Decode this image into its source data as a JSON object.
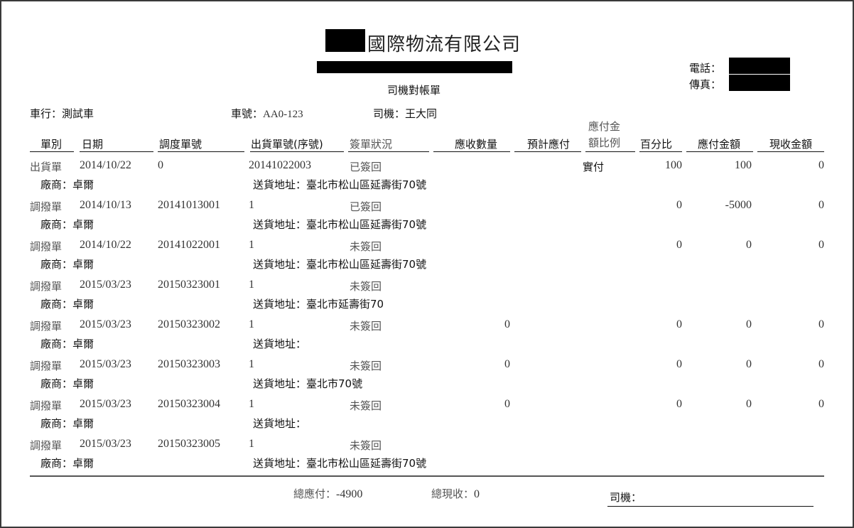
{
  "header": {
    "company_name": "國際物流有限公司",
    "doc_title": "司機對帳單",
    "phone_label": "電話：",
    "fax_label": "傳真："
  },
  "info": {
    "carrier_label": "車行：測試車",
    "plate_label": "車號：",
    "plate_value": "AA0-123",
    "driver_label": "司機：王大同"
  },
  "columns": {
    "type": "單別",
    "date": "日期",
    "dispatch_no": "調度單號",
    "ship_no": "出貨單號(序號)",
    "sign_status": "簽單狀況",
    "recv_qty": "應收數量",
    "est_pay": "預計應付",
    "pay_ratio_line1": "應付金",
    "pay_ratio_line2": "額比例",
    "percent": "百分比",
    "pay_amount": "應付金額",
    "cash_amount": "現收金額"
  },
  "rows": [
    {
      "type": "出貨單",
      "date": "2014/10/22",
      "dispatch": "0",
      "ship": "20141022003",
      "status": "已簽回",
      "qty": "",
      "ratio": "實付",
      "percent": "100",
      "pay": "100",
      "cash": "0",
      "vendor": "廠商：卓爾",
      "address": "送貨地址：臺北市松山區延壽街70號"
    },
    {
      "type": "調撥單",
      "date": "2014/10/13",
      "dispatch": "20141013001",
      "ship": "1",
      "status": "已簽回",
      "qty": "",
      "ratio": "",
      "percent": "0",
      "pay": "-5000",
      "cash": "0",
      "vendor": "廠商：卓爾",
      "address": "送貨地址：臺北市松山區延壽街70號"
    },
    {
      "type": "調撥單",
      "date": "2014/10/22",
      "dispatch": "20141022001",
      "ship": "1",
      "status": "未簽回",
      "qty": "",
      "ratio": "",
      "percent": "0",
      "pay": "0",
      "cash": "0",
      "vendor": "廠商：卓爾",
      "address": "送貨地址：臺北市松山區延壽街70號"
    },
    {
      "type": "調撥單",
      "date": "2015/03/23",
      "dispatch": "20150323001",
      "ship": "1",
      "status": "未簽回",
      "qty": "",
      "ratio": "",
      "percent": "",
      "pay": "",
      "cash": "",
      "vendor": "廠商：卓爾",
      "address": "送貨地址：臺北市延壽街70"
    },
    {
      "type": "調撥單",
      "date": "2015/03/23",
      "dispatch": "20150323002",
      "ship": "1",
      "status": "未簽回",
      "qty": "0",
      "ratio": "",
      "percent": "0",
      "pay": "0",
      "cash": "0",
      "vendor": "廠商：卓爾",
      "address": "送貨地址："
    },
    {
      "type": "調撥單",
      "date": "2015/03/23",
      "dispatch": "20150323003",
      "ship": "1",
      "status": "未簽回",
      "qty": "0",
      "ratio": "",
      "percent": "0",
      "pay": "0",
      "cash": "0",
      "vendor": "廠商：卓爾",
      "address": "送貨地址：臺北市70號"
    },
    {
      "type": "調撥單",
      "date": "2015/03/23",
      "dispatch": "20150323004",
      "ship": "1",
      "status": "未簽回",
      "qty": "0",
      "ratio": "",
      "percent": "0",
      "pay": "0",
      "cash": "0",
      "vendor": "廠商：卓爾",
      "address": "送貨地址："
    },
    {
      "type": "調撥單",
      "date": "2015/03/23",
      "dispatch": "20150323005",
      "ship": "1",
      "status": "未簽回",
      "qty": "",
      "ratio": "",
      "percent": "",
      "pay": "",
      "cash": "",
      "vendor": "廠商：卓爾",
      "address": "送貨地址：臺北市松山區延壽街70號"
    }
  ],
  "footer": {
    "total_pay_label": "總應付：",
    "total_pay_value": "-4900",
    "total_cash_label": "總現收：",
    "total_cash_value": "0",
    "driver_sign_label": "司機："
  }
}
